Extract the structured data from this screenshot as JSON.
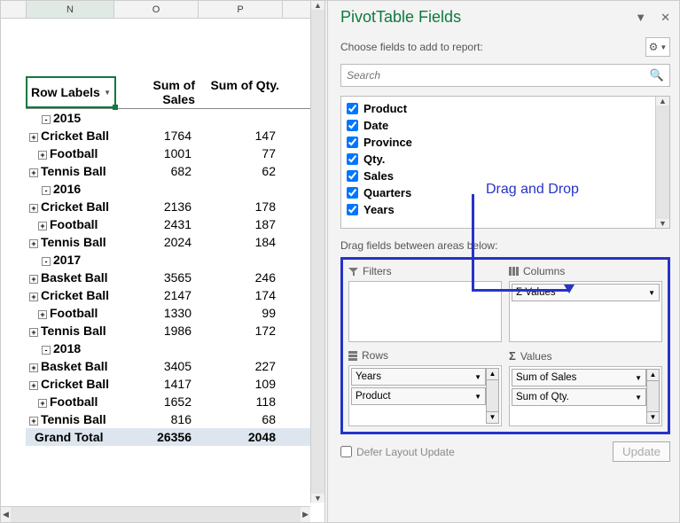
{
  "pane_title": "PivotTable Fields",
  "subtitle": "Choose fields to add to report:",
  "search_placeholder": "Search",
  "columns": {
    "N": "N",
    "O": "O",
    "P": "P"
  },
  "pivot_header": {
    "rows": "Row Labels",
    "sales": "Sum of Sales",
    "qty": "Sum of Qty."
  },
  "rows": [
    {
      "type": "year",
      "label": "2015",
      "exp": "-"
    },
    {
      "type": "prod",
      "label": "Cricket Ball",
      "sales": "1764",
      "qty": "147",
      "exp": "+"
    },
    {
      "type": "sub",
      "label": "Football",
      "sales": "1001",
      "qty": "77",
      "exp": "+"
    },
    {
      "type": "prod",
      "label": "Tennis Ball",
      "sales": "682",
      "qty": "62",
      "exp": "+"
    },
    {
      "type": "year",
      "label": "2016",
      "exp": "-"
    },
    {
      "type": "prod",
      "label": "Cricket Ball",
      "sales": "2136",
      "qty": "178",
      "exp": "+"
    },
    {
      "type": "sub",
      "label": "Football",
      "sales": "2431",
      "qty": "187",
      "exp": "+"
    },
    {
      "type": "prod",
      "label": "Tennis Ball",
      "sales": "2024",
      "qty": "184",
      "exp": "+"
    },
    {
      "type": "year",
      "label": "2017",
      "exp": "-"
    },
    {
      "type": "prod",
      "label": "Basket Ball",
      "sales": "3565",
      "qty": "246",
      "exp": "+"
    },
    {
      "type": "prod",
      "label": "Cricket Ball",
      "sales": "2147",
      "qty": "174",
      "exp": "+"
    },
    {
      "type": "sub",
      "label": "Football",
      "sales": "1330",
      "qty": "99",
      "exp": "+"
    },
    {
      "type": "prod",
      "label": "Tennis Ball",
      "sales": "1986",
      "qty": "172",
      "exp": "+"
    },
    {
      "type": "year",
      "label": "2018",
      "exp": "-"
    },
    {
      "type": "prod",
      "label": "Basket Ball",
      "sales": "3405",
      "qty": "227",
      "exp": "+"
    },
    {
      "type": "prod",
      "label": "Cricket Ball",
      "sales": "1417",
      "qty": "109",
      "exp": "+"
    },
    {
      "type": "sub",
      "label": "Football",
      "sales": "1652",
      "qty": "118",
      "exp": "+"
    },
    {
      "type": "prod",
      "label": "Tennis Ball",
      "sales": "816",
      "qty": "68",
      "exp": "+"
    }
  ],
  "grand_total": {
    "label": "Grand Total",
    "sales": "26356",
    "qty": "2048"
  },
  "fields": [
    "Product",
    "Date",
    "Province",
    "Qty.",
    "Sales",
    "Quarters",
    "Years"
  ],
  "areas_label": "Drag fields between areas below:",
  "area_headers": {
    "filters": "Filters",
    "columns": "Columns",
    "rows": "Rows",
    "values": "Values"
  },
  "area_items": {
    "columns": [
      {
        "name": "Values",
        "sigma": true
      }
    ],
    "rows": [
      {
        "name": "Years"
      },
      {
        "name": "Product"
      }
    ],
    "values": [
      {
        "name": "Sum of Sales"
      },
      {
        "name": "Sum of Qty."
      }
    ]
  },
  "footer": {
    "defer": "Defer Layout Update",
    "update": "Update"
  },
  "callout": "Drag and Drop"
}
